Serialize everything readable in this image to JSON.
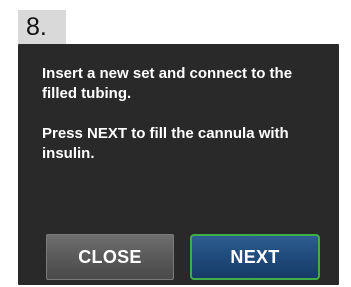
{
  "step": {
    "number_label": "8."
  },
  "screen": {
    "message_line_1": "Insert a new set and connect to the filled tubing.",
    "message_line_2": "Press NEXT to fill the cannula with insulin."
  },
  "buttons": {
    "close_label": "CLOSE",
    "next_label": "NEXT"
  },
  "colors": {
    "screen_background": "#292929",
    "next_button": "#1f4a7c",
    "next_button_border": "#3fae49",
    "close_button": "#5a5a5a"
  }
}
